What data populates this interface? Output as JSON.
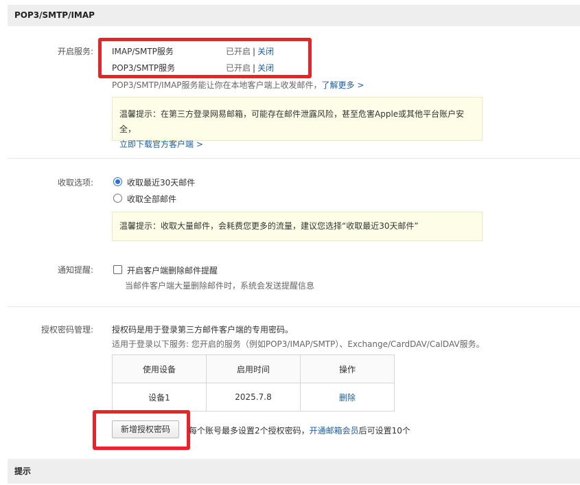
{
  "headers": {
    "settings": "POP3/SMTP/IMAP",
    "tips": "提示"
  },
  "service": {
    "label": "开启服务:",
    "rows": [
      {
        "name": "IMAP/SMTP服务",
        "status": "已开启",
        "separator": "|",
        "action": "关闭"
      },
      {
        "name": "POP3/SMTP服务",
        "status": "已开启",
        "separator": "|",
        "action": "关闭"
      }
    ],
    "desc": "POP3/SMTP/IMAP服务能让你在本地客户端上收发邮件，",
    "learn_more": "了解更多 >",
    "tip_line1": "温馨提示：在第三方登录网易邮箱，可能存在邮件泄露风险，甚至危害Apple或其他平台账户安全，",
    "tip_link": "立即下载官方客户端 >"
  },
  "receive": {
    "label": "收取选项:",
    "options": [
      {
        "label": "收取最近30天邮件",
        "selected": true
      },
      {
        "label": "收取全部邮件",
        "selected": false
      }
    ],
    "tip": "温馨提示：收取大量邮件，会耗费您更多的流量，建议您选择“收取最近30天邮件”"
  },
  "notify": {
    "label": "通知提醒:",
    "checkbox_label": "开启客户端删除邮件提醒",
    "checked": false,
    "desc": "当邮件客户端大量删除邮件时，系统会发送提醒信息"
  },
  "auth": {
    "label": "授权密码管理:",
    "line1": "授权码是用于登录第三方邮件客户端的专用密码。",
    "line2": "适用于登录以下服务: 您开启的服务（例如POP3/IMAP/SMTP）、Exchange/CardDAV/CalDAV服务。",
    "columns": [
      "使用设备",
      "启用时间",
      "操作"
    ],
    "rows": [
      {
        "device": "设备1",
        "date": "2025.7.8",
        "action": "删除"
      }
    ],
    "add_button": "新增授权密码",
    "limit_text": "每个账号最多设置2个授权密码，",
    "vip_link": "开通邮箱会员",
    "limit_suffix": "后可设置10个"
  },
  "colors": {
    "highlight": "#e8232a",
    "link": "#1a5ea8",
    "header_bg": "#eeeeee",
    "tip_bg": "#fefee8"
  }
}
